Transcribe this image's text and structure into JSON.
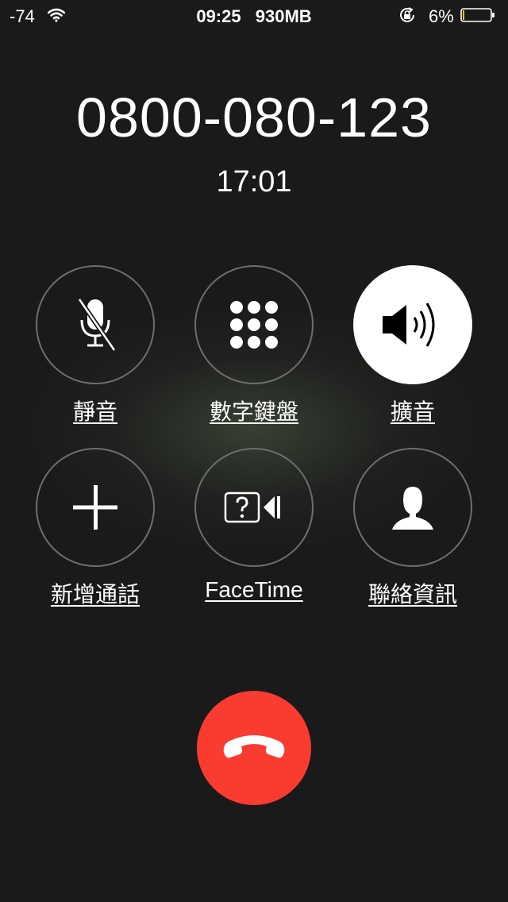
{
  "status_bar": {
    "signal": "-74",
    "time": "09:25",
    "memory": "930MB",
    "battery_percent": "6%",
    "battery_level": 0.06
  },
  "call": {
    "number": "0800-080-123",
    "duration": "17:01"
  },
  "controls": {
    "mute_label": "靜音",
    "keypad_label": "數字鍵盤",
    "speaker_label": "擴音",
    "add_call_label": "新增通話",
    "facetime_label": "FaceTime",
    "contacts_label": "聯絡資訊"
  },
  "colors": {
    "background": "#1a1a1a",
    "end_call": "#fa3b30",
    "speaker_active": "#ffffff"
  }
}
